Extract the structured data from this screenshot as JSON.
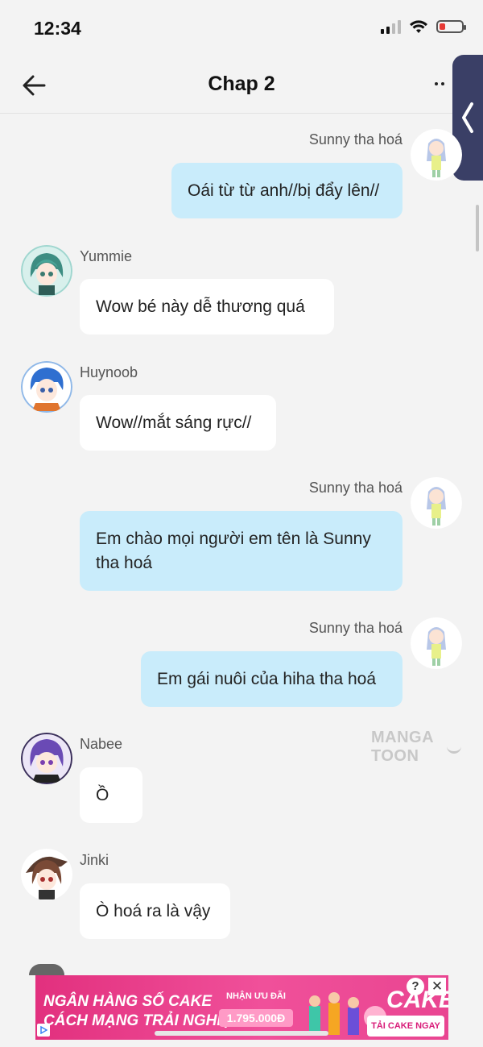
{
  "status_bar": {
    "time": "12:34"
  },
  "header": {
    "title": "Chap 2",
    "back_icon": "back-arrow-icon",
    "more_icon": "more-dots-icon",
    "side_tab_icon": "chevron-left-icon"
  },
  "messages": [
    {
      "side": "right",
      "name": "Sunny tha hoá",
      "text": "Oái từ từ anh//bị đẩy lên//"
    },
    {
      "side": "left",
      "name": "Yummie",
      "text": "Wow bé này dễ thương quá"
    },
    {
      "side": "left",
      "name": "Huynoob",
      "text": "Wow//mắt sáng rực//"
    },
    {
      "side": "right",
      "name": "Sunny tha hoá",
      "text": "Em chào mọi người em tên là Sunny tha hoá"
    },
    {
      "side": "right",
      "name": "Sunny tha hoá",
      "text": "Em gái nuôi của hiha tha hoá"
    },
    {
      "side": "left",
      "name": "Nabee",
      "text": "Ồ"
    },
    {
      "side": "left",
      "name": "Jinki",
      "text": "Ò hoá ra là vậy"
    }
  ],
  "watermark": "MANGA TOON",
  "ad": {
    "line1": "NGÂN HÀNG SỐ CAKE",
    "line2": "CÁCH MẠNG TRẢI NGHIỆM",
    "offer_label": "NHẬN ƯU ĐÃI",
    "offer_amount": "1.795.000Đ",
    "brand": "CAKE",
    "cta": "TẢI CAKE NGAY",
    "help": "?",
    "close": "✕"
  },
  "colors": {
    "background": "#f3f3f3",
    "own_bubble": "#c9ecfb",
    "other_bubble": "#ffffff",
    "side_tab": "#3a3f66",
    "ad_pink": "#e2307e"
  }
}
